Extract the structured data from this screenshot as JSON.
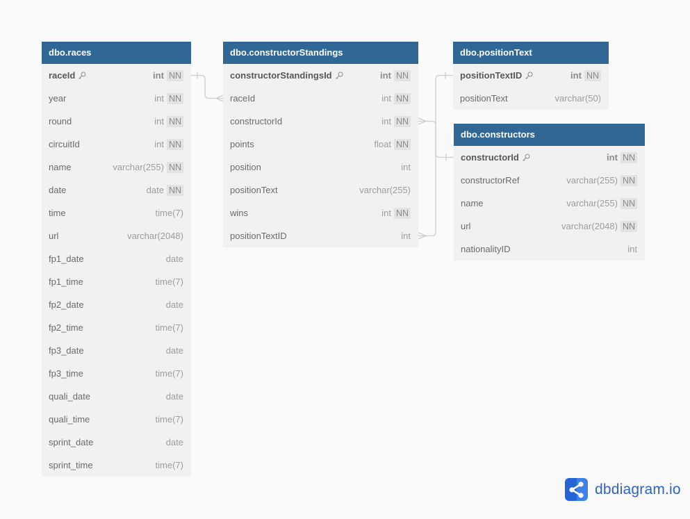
{
  "tables": [
    {
      "name": "dbo.races",
      "columns": [
        {
          "name": "raceId",
          "type": "int",
          "constraint": "NN",
          "pk": true
        },
        {
          "name": "year",
          "type": "int",
          "constraint": "NN"
        },
        {
          "name": "round",
          "type": "int",
          "constraint": "NN"
        },
        {
          "name": "circuitId",
          "type": "int",
          "constraint": "NN"
        },
        {
          "name": "name",
          "type": "varchar(255)",
          "constraint": "NN"
        },
        {
          "name": "date",
          "type": "date",
          "constraint": "NN"
        },
        {
          "name": "time",
          "type": "time(7)"
        },
        {
          "name": "url",
          "type": "varchar(2048)"
        },
        {
          "name": "fp1_date",
          "type": "date"
        },
        {
          "name": "fp1_time",
          "type": "time(7)"
        },
        {
          "name": "fp2_date",
          "type": "date"
        },
        {
          "name": "fp2_time",
          "type": "time(7)"
        },
        {
          "name": "fp3_date",
          "type": "date"
        },
        {
          "name": "fp3_time",
          "type": "time(7)"
        },
        {
          "name": "quali_date",
          "type": "date"
        },
        {
          "name": "quali_time",
          "type": "time(7)"
        },
        {
          "name": "sprint_date",
          "type": "date"
        },
        {
          "name": "sprint_time",
          "type": "time(7)"
        }
      ]
    },
    {
      "name": "dbo.constructorStandings",
      "columns": [
        {
          "name": "constructorStandingsId",
          "type": "int",
          "constraint": "NN",
          "pk": true
        },
        {
          "name": "raceId",
          "type": "int",
          "constraint": "NN"
        },
        {
          "name": "constructorId",
          "type": "int",
          "constraint": "NN"
        },
        {
          "name": "points",
          "type": "float",
          "constraint": "NN"
        },
        {
          "name": "position",
          "type": "int"
        },
        {
          "name": "positionText",
          "type": "varchar(255)"
        },
        {
          "name": "wins",
          "type": "int",
          "constraint": "NN"
        },
        {
          "name": "positionTextID",
          "type": "int"
        }
      ]
    },
    {
      "name": "dbo.positionText",
      "columns": [
        {
          "name": "positionTextID",
          "type": "int",
          "constraint": "NN",
          "pk": true
        },
        {
          "name": "positionText",
          "type": "varchar(50)"
        }
      ]
    },
    {
      "name": "dbo.constructors",
      "columns": [
        {
          "name": "constructorId",
          "type": "int",
          "constraint": "NN",
          "pk": true
        },
        {
          "name": "constructorRef",
          "type": "varchar(255)",
          "constraint": "NN"
        },
        {
          "name": "name",
          "type": "varchar(255)",
          "constraint": "NN"
        },
        {
          "name": "url",
          "type": "varchar(2048)",
          "constraint": "NN"
        },
        {
          "name": "nationalityID",
          "type": "int"
        }
      ]
    }
  ],
  "relationships": [
    {
      "from": "dbo.races.raceId",
      "to": "dbo.constructorStandings.raceId",
      "cardinality": "one-to-many"
    },
    {
      "from": "dbo.constructors.constructorId",
      "to": "dbo.constructorStandings.constructorId",
      "cardinality": "one-to-many"
    },
    {
      "from": "dbo.positionText.positionTextID",
      "to": "dbo.constructorStandings.positionTextID",
      "cardinality": "one-to-many"
    }
  ],
  "branding": {
    "text": "dbdiagram.io",
    "icon": "share-nodes-icon",
    "colors": {
      "icon_dark": "#2563d6",
      "icon_light": "#3d82e8",
      "text": "#2e62c3"
    }
  },
  "colors": {
    "header": "#316794",
    "row_bg": "#f1f1f1",
    "page_bg": "#fafafa",
    "link": "#cdcdcd"
  }
}
